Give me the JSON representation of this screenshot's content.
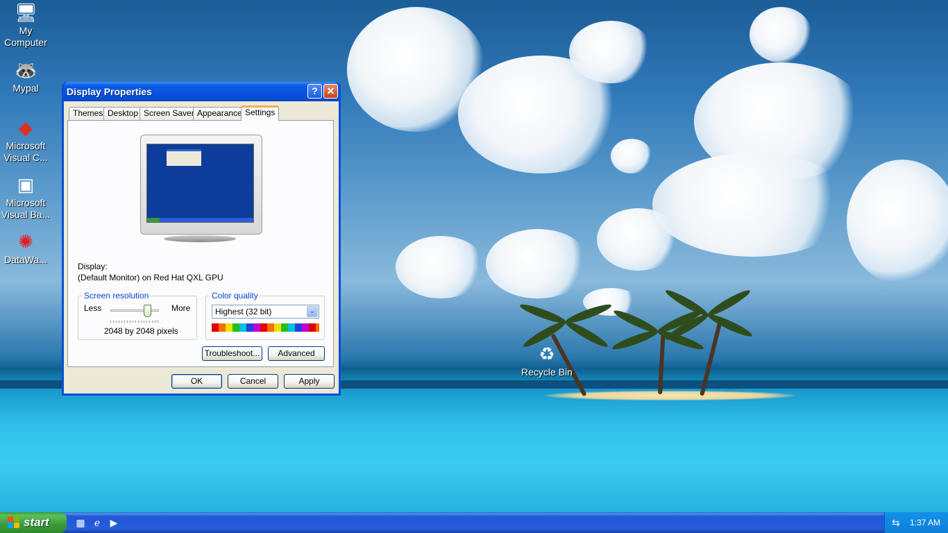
{
  "desktop": {
    "icons": [
      {
        "label": "My\nComputer",
        "icon": "computer-icon"
      },
      {
        "label": "Mypal",
        "icon": "raccoon-browser-icon"
      },
      {
        "label": "Microsoft\nVisual C...",
        "icon": "visual-c-icon"
      },
      {
        "label": "Microsoft\nVisual Ba...",
        "icon": "visual-basic-icon"
      },
      {
        "label": "DataWa...",
        "icon": "datawa-icon"
      }
    ],
    "recycle_bin": {
      "label": "Recycle Bin",
      "icon": "recycle-bin-icon"
    }
  },
  "dialog": {
    "title": "Display Properties",
    "help_glyph": "?",
    "close_glyph": "✕",
    "tabs": [
      "Themes",
      "Desktop",
      "Screen Saver",
      "Appearance",
      "Settings"
    ],
    "active_tab": "Settings",
    "display_label": "Display:",
    "display_value": "(Default Monitor) on Red Hat QXL GPU",
    "resolution": {
      "group_title": "Screen resolution",
      "less": "Less",
      "more": "More",
      "value_text": "2048 by 2048 pixels",
      "slider_level": 0.75
    },
    "color_quality": {
      "group_title": "Color quality",
      "selected": "Highest (32 bit)",
      "dropdown_glyph": "⌄"
    },
    "buttons": {
      "troubleshoot": "Troubleshoot...",
      "advanced": "Advanced",
      "ok": "OK",
      "cancel": "Cancel",
      "apply": "Apply"
    }
  },
  "taskbar": {
    "start_label": "start",
    "quick_launch": [
      "show-desktop-icon",
      "internet-explorer-icon",
      "media-player-icon"
    ],
    "clock": "1:37 AM",
    "tray_icon": "network-icon"
  },
  "colors": {
    "title_blue": "#0551e0",
    "start_green": "#3a9a3a",
    "tab_highlight": "#f0b04a",
    "group_title": "#0046d5"
  }
}
